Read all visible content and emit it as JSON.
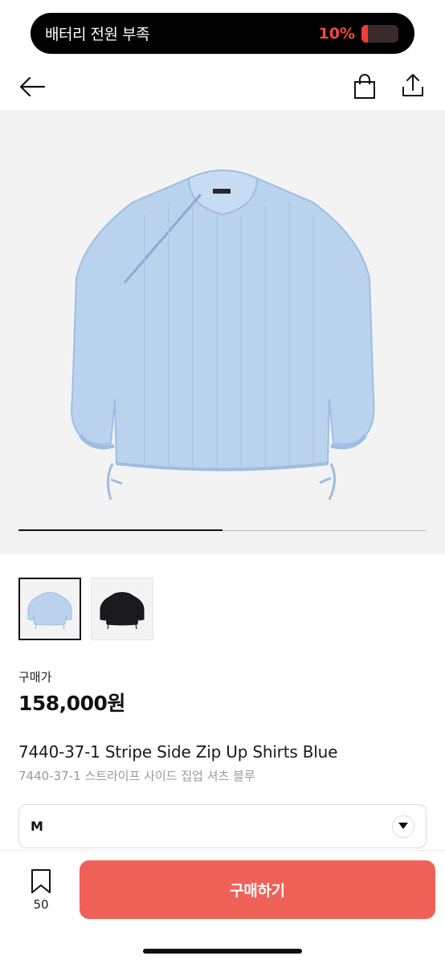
{
  "battery": {
    "message": "배터리 전원 부족",
    "percent_text": "10%",
    "level": 0.1,
    "color": "#f24a3f"
  },
  "top_bar": {
    "back_icon": "arrow-left-icon",
    "bag_icon": "shopping-bag-icon",
    "share_icon": "share-icon"
  },
  "gallery": {
    "progress": 0.5,
    "thumbnails": [
      {
        "color": "light-blue",
        "selected": true
      },
      {
        "color": "black",
        "selected": false
      }
    ]
  },
  "price": {
    "label": "구매가",
    "value": "158,000원"
  },
  "product": {
    "title_en": "7440-37-1 Stripe Side Zip Up Shirts Blue",
    "title_ko": "7440-37-1 스트라이프 사이드 집업 셔츠 블루"
  },
  "option": {
    "selected": "M"
  },
  "bottom_bar": {
    "wish_count": "50",
    "buy_label": "구매하기",
    "accent": "#ef6157"
  }
}
